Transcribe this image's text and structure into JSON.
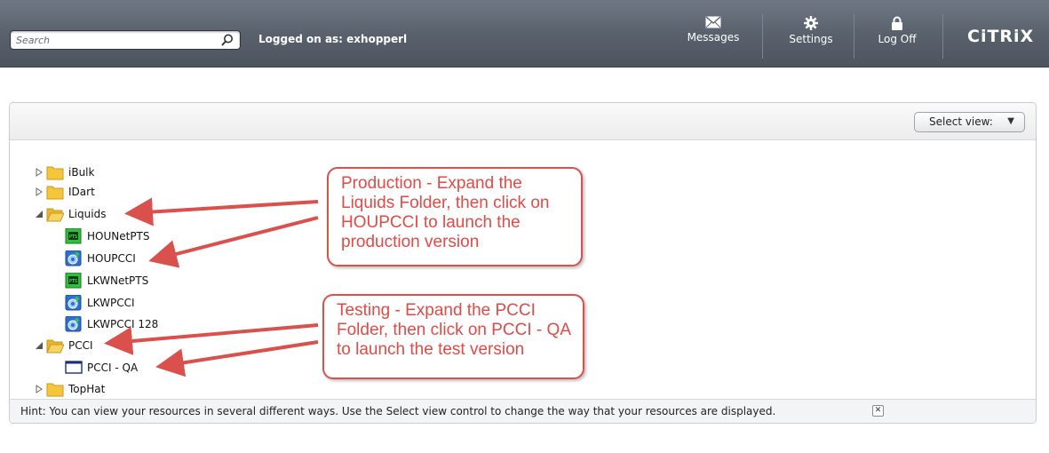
{
  "header": {
    "search_placeholder": "Search",
    "logged_on": "Logged on as: exhopperl",
    "messages": "Messages",
    "settings": "Settings",
    "log_off": "Log Off",
    "brand": "CiTRiX"
  },
  "toolbar": {
    "select_view": "Select view:",
    "select_view_arrow": "▼"
  },
  "tree": {
    "ibulk": "iBulk",
    "idart": "IDart",
    "liquids": "Liquids",
    "houppts": "HOUNetPTS",
    "houpcci": "HOUPCCI",
    "lkwnetpts": "LKWNetPTS",
    "lkwpcci": "LKWPCCI",
    "lkwpcci128": "LKWPCCI 128",
    "pcci": "PCCI",
    "pcci_qa": "PCCI - QA",
    "tophat": "TopHat"
  },
  "callouts": {
    "production": "Production - Expand the Liquids Folder, then click on HOUPCCI to launch the production version",
    "testing": "Testing - Expand the PCCI Folder, then click on PCCI - QA to launch the test version"
  },
  "hint": {
    "text": "Hint: You can view your resources in several different ways. Use the Select view control to change the way that your resources are displayed.",
    "close": "✕"
  },
  "colors": {
    "topbar": "#5a626d",
    "callout": "#d9504c",
    "folder": "#f5c53b"
  }
}
